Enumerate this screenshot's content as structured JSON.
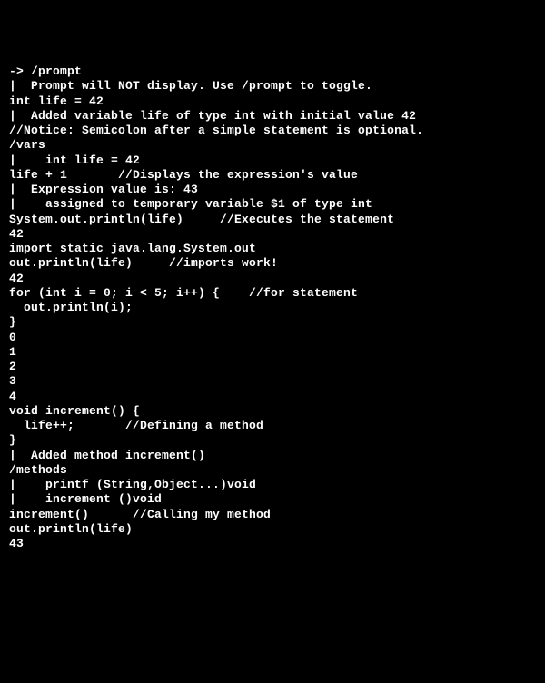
{
  "lines": [
    "-> /prompt",
    "|  Prompt will NOT display. Use /prompt to toggle.",
    "",
    "int life = 42",
    "|  Added variable life of type int with initial value 42",
    "",
    "//Notice: Semicolon after a simple statement is optional.",
    "",
    "/vars",
    "|    int life = 42",
    "",
    "life + 1       //Displays the expression's value",
    "|  Expression value is: 43",
    "|    assigned to temporary variable $1 of type int",
    "",
    "System.out.println(life)     //Executes the statement",
    "42",
    "",
    "import static java.lang.System.out",
    "",
    "out.println(life)     //imports work!",
    "42",
    "",
    "for (int i = 0; i < 5; i++) {    //for statement",
    "  out.println(i);",
    "}",
    "0",
    "1",
    "2",
    "3",
    "4",
    "",
    "void increment() {",
    "  life++;       //Defining a method",
    "}",
    "|  Added method increment()",
    "",
    "/methods",
    "|    printf (String,Object...)void",
    "|    increment ()void",
    "",
    "increment()      //Calling my method",
    "",
    "out.println(life)",
    "43"
  ]
}
